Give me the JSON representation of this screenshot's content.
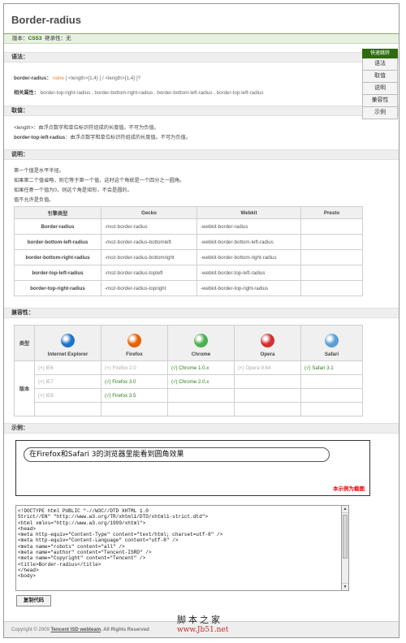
{
  "page": {
    "title": "Border-radius",
    "version_line": {
      "version_label": "版本：",
      "version": "CSS3",
      "inherit": "继承性：无"
    }
  },
  "quick_nav": {
    "heading": "快速跳转",
    "items": [
      "语法",
      "取值",
      "说明",
      "兼容性",
      "示例"
    ]
  },
  "syntax": {
    "heading": "语法：",
    "prop": "border-radius：",
    "none": "none",
    "value": "| <length>{1,4} [ / <length>{1,4} ]?",
    "related_label": "相关属性：",
    "related": "border-top-right-radius , border-bottom-right-radius , border-bottom-left-radius , border-top-left-radius"
  },
  "values": {
    "heading": "取值：",
    "length_name": "<length>",
    "length_desc": "：由浮点数字和单位标识符组成的长度值。不可为负值。",
    "tl_name": "border-top-left-radius",
    "tl_desc": "：由浮点数字和单位标识符组成的长度值。不可为负值。"
  },
  "notes": {
    "heading": "说明：",
    "lines": [
      "第一个值是水平半径。",
      "如果第二个值省略，则它等于第一个值，这时这个角就是一个四分之一圆角。",
      "如果任意一个值为0，则这个角是矩形，不会是圆的。",
      "值不允许是负值。"
    ]
  },
  "engine_table": {
    "headers": [
      "引擎类型",
      "Gecko",
      "Webkit",
      "Presto"
    ],
    "rows": [
      [
        "Border-radius",
        "-moz-border-radius",
        "-webkit-border-radius",
        ""
      ],
      [
        "border-bottom-left-radius",
        "-moz-border-radius-bottomleft",
        "-webkit-border-bottom-left-radius",
        ""
      ],
      [
        "border-bottom-right-radius",
        "-moz-border-radius-bottomright",
        "-webkit-border-bottom-right-radius",
        ""
      ],
      [
        "border-top-left-radius",
        "-moz-border-radius-topleft",
        "-webkit-border-top-left-radius",
        ""
      ],
      [
        "border-top-right-radius",
        "-moz-border-radius-topright",
        "-webkit-border-top-right-radius",
        ""
      ]
    ]
  },
  "compat": {
    "heading": "兼容性：",
    "type_label": "类型",
    "version_label": "版本",
    "browsers": [
      "Internet Explorer",
      "Firefox",
      "Chrome",
      "Opera",
      "Safari"
    ],
    "browser_icon_colors": [
      "#1f73c9",
      "#e66000",
      "#4caf50",
      "#d32f2f",
      "#5a9fd4"
    ],
    "rows": [
      [
        "(×) IE6",
        "(×) Firefox 2.0",
        "(√) Chrome 1.0.x",
        "(×) Opera 9.64",
        "(√) Safari 3.1"
      ],
      [
        "(×) IE7",
        "(√) Firefox 3.0",
        "(√) Chrome 2.0.x",
        "",
        ""
      ],
      [
        "(×) IE8",
        "(√) Firefox 3.5",
        "",
        "",
        ""
      ],
      [
        "",
        "",
        "",
        "",
        ""
      ]
    ]
  },
  "example": {
    "heading": "示例：",
    "demo_text": "在Firefox和Safari 3的浏览器里能看到圆角效果",
    "screenshot_note": "本示例为截图",
    "code": "<!DOCTYPE html PUBLIC \"-//W3C//DTD XHTML 1.0\nStrict//EN\" \"http://www.w3.org/TR/xhtml1/DTD/xhtml1-strict.dtd\">\n<html xmlns=\"http://www.w3.org/1999/xhtml\">\n<head>\n<meta http-equiv=\"Content-Type\" content=\"text/html; charset=utf-8\" />\n<meta http-equiv=\"Content-Language\" content=\"utf-8\" />\n<meta name=\"robots\" content=\"all\" />\n<meta name=\"author\" content=\"Tencent-ISRD\" />\n<meta name=\"Copyright\" content=\"Tencent\" />\n<title>Border-radius</title>\n</head>\n<body>",
    "copy_button": "复制代码"
  },
  "footer": {
    "prefix": "Copyright © 2009 ",
    "team": "Tencent ISD webteam",
    "suffix": ". All Rights Reserved"
  },
  "watermark": {
    "line1": "脚本之家",
    "line2": "www.Jb51.net"
  }
}
